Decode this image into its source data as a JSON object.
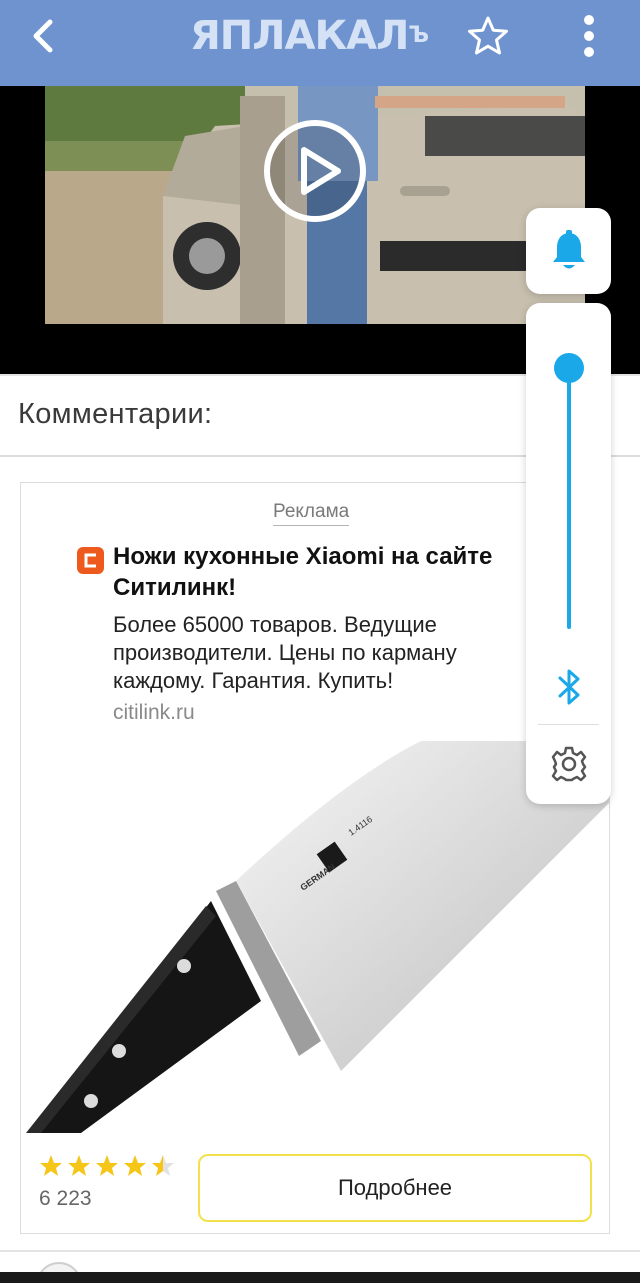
{
  "header": {
    "logo_text": "ЯПЛАКАЛ",
    "logo_suffix": "Ъ",
    "back_icon": "back-arrow-icon",
    "star_icon": "star-outline-icon",
    "menu_icon": "more-vertical-icon",
    "background_color": "#6f93cf"
  },
  "video": {
    "play_icon": "play-icon"
  },
  "comments": {
    "title": "Комментарии:"
  },
  "ad": {
    "label": "Реклама",
    "favicon_icon": "citilink-logo-icon",
    "title": "Ножи кухонные Xiaomi на сайте Ситилинк!",
    "description": "Более 65000 товаров. Ведущие производители. Цены по карману каждому. Гарантия. Купить!",
    "domain": "citilink.ru",
    "rating": 4.5,
    "rating_max": 5,
    "reviews_count": "6 223",
    "button_label": "Подробнее",
    "button_border_color": "#f2e14a",
    "knife_blade_text": "GERMAN",
    "knife_blade_code": "1.4116"
  },
  "volume_panel": {
    "bell_icon": "bell-icon",
    "level": 0.96,
    "bluetooth_icon": "bluetooth-icon",
    "settings_icon": "gear-icon",
    "accent_color": "#1aa8e8"
  }
}
